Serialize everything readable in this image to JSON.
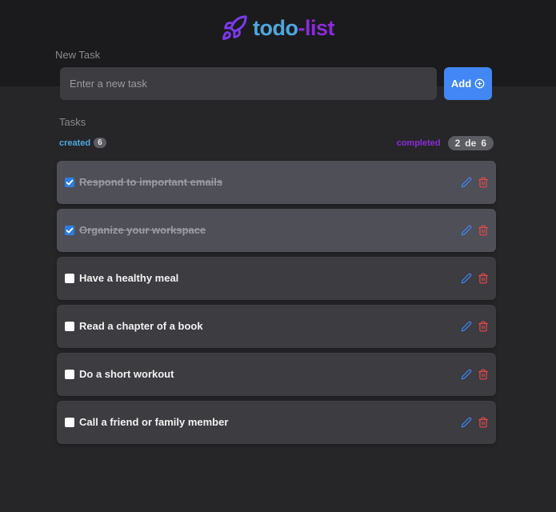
{
  "app": {
    "logo_icon": "rocket-icon",
    "title_part1": "todo",
    "title_part2": "-list",
    "colors": {
      "todo_blue": "#4ea8de",
      "list_purple": "#8b2bd9",
      "accent_button": "#4287f5"
    }
  },
  "form": {
    "label": "New Task",
    "placeholder": "Enter a new task",
    "value": "",
    "add_label": "Add",
    "add_icon": "plus-circle-icon"
  },
  "summary": {
    "section_label": "Tasks",
    "created_label": "created",
    "created_count": "6",
    "completed_label": "completed",
    "completed_done": "2",
    "completed_of": "de",
    "completed_total": "6"
  },
  "tasks": [
    {
      "text": "Respond to important emails",
      "completed": true
    },
    {
      "text": "Organize your workspace",
      "completed": true
    },
    {
      "text": "Have a healthy meal",
      "completed": false
    },
    {
      "text": "Read a chapter of a book",
      "completed": false
    },
    {
      "text": "Do a short workout",
      "completed": false
    },
    {
      "text": "Call a friend or family member",
      "completed": false
    }
  ],
  "icons": {
    "edit": "pencil-icon",
    "delete": "trash-icon",
    "check": "checkmark-icon"
  }
}
